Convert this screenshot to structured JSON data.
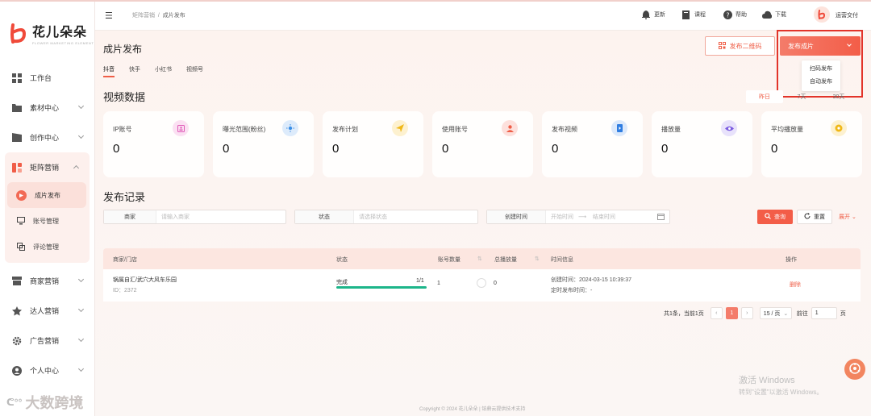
{
  "app": {
    "name": "花儿朵朵",
    "name_en": "FLOWER MARKETING ELEMENT",
    "accent": "#f35d48"
  },
  "sidebar": {
    "items": [
      {
        "label": "工作台",
        "icon": "dashboard-icon"
      },
      {
        "label": "素材中心",
        "icon": "folder-icon"
      },
      {
        "label": "创作中心",
        "icon": "clapper-icon"
      },
      {
        "label": "矩阵营销",
        "icon": "matrix-icon",
        "expanded": true,
        "children": [
          {
            "label": "成片发布",
            "icon": "publish-icon",
            "active": true
          },
          {
            "label": "账号管理",
            "icon": "monitor-icon"
          },
          {
            "label": "评论管理",
            "icon": "comment-icon"
          }
        ]
      },
      {
        "label": "商家营销",
        "icon": "store-icon"
      },
      {
        "label": "达人营销",
        "icon": "star-user-icon"
      },
      {
        "label": "广告营销",
        "icon": "ad-gear-icon"
      },
      {
        "label": "个人中心",
        "icon": "user-icon"
      }
    ],
    "watermark": "大数跨境"
  },
  "topbar": {
    "breadcrumb": [
      "矩阵营销",
      "成片发布"
    ],
    "items": [
      {
        "label": "更新",
        "icon": "bell-icon"
      },
      {
        "label": "课程",
        "icon": "book-icon"
      },
      {
        "label": "帮助",
        "icon": "help-icon"
      },
      {
        "label": "下载",
        "icon": "cloud-download-icon"
      }
    ],
    "user": "运营交付"
  },
  "main": {
    "title": "成片发布",
    "qr_button": "发布二维码",
    "publish_button": "发布成片",
    "publish_menu": [
      "扫码发布",
      "自动发布"
    ],
    "platform_tabs": [
      {
        "label": "抖音",
        "active": true
      },
      {
        "label": "快手"
      },
      {
        "label": "小红书"
      },
      {
        "label": "视频号"
      }
    ],
    "video_section": "视频数据",
    "date_tabs": [
      {
        "label": "昨日",
        "active": true
      },
      {
        "label": "7天"
      },
      {
        "label": "30天"
      }
    ],
    "stats": [
      {
        "label": "IP账号",
        "value": "0",
        "color": "#e05ab8",
        "bg": "#fbe0f2",
        "icon": "id-badge-icon"
      },
      {
        "label": "曝光范围(粉丝)",
        "value": "0",
        "color": "#3a8ee6",
        "bg": "#ddebfb",
        "icon": "sun-icon"
      },
      {
        "label": "发布计划",
        "value": "0",
        "color": "#f0b818",
        "bg": "#fdf1cf",
        "icon": "send-icon"
      },
      {
        "label": "使用账号",
        "value": "0",
        "color": "#ef5e47",
        "bg": "#fde0dc",
        "icon": "person-icon"
      },
      {
        "label": "发布视频",
        "value": "0",
        "color": "#2f7de1",
        "bg": "#dce9fb",
        "icon": "phone-icon"
      },
      {
        "label": "播放量",
        "value": "0",
        "color": "#7b5ce0",
        "bg": "#e8e2fb",
        "icon": "eye-icon"
      },
      {
        "label": "平均播放量",
        "value": "0",
        "color": "#f0b818",
        "bg": "#fdf1cf",
        "icon": "coin-icon"
      }
    ],
    "records_section": "发布记录",
    "filters": {
      "merchant_label": "商家",
      "merchant_placeholder": "请输入商家",
      "status_label": "状态",
      "status_placeholder": "请选择状态",
      "time_label": "创建时间",
      "start_placeholder": "开始时间",
      "end_placeholder": "结束时间",
      "search": "查询",
      "reset": "重置",
      "expand": "展开"
    },
    "table": {
      "headers": [
        "商家/门店",
        "状态",
        "账号数量",
        "总播放量",
        "时间信息",
        "操作"
      ],
      "rows": [
        {
          "merchant": "锅属自汇/武穴大风车乐园",
          "id": "ID：2372",
          "status": "完成",
          "progress_text": "1/1",
          "progress": 1.0,
          "accounts": "1",
          "plays": "0",
          "created": "创建时间：2024-03-15 10:39:37",
          "scheduled": "定时发布时间：-",
          "action": "删除"
        }
      ]
    },
    "pagination": {
      "summary": "共1条，当前1页",
      "current": "1",
      "page_size": "15 / 页",
      "goto_label": "前往",
      "goto_value": "1",
      "page_suffix": "页"
    },
    "footer": "Copyright © 2024 花儿朵朵 | 铂鼎云提供技术支持",
    "os_watermark_title": "激活 Windows",
    "os_watermark_sub": "转到\"设置\"以激活 Windows。"
  }
}
